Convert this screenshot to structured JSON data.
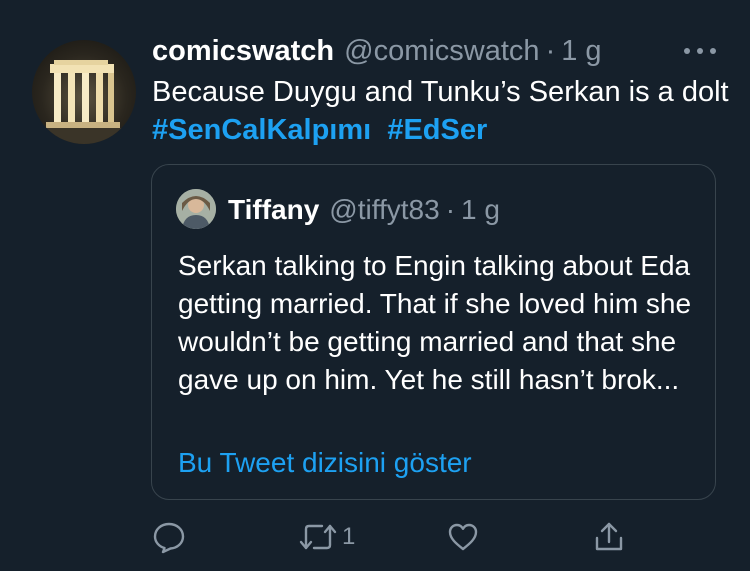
{
  "tweet": {
    "display_name": "comicswatch",
    "handle": "@comicswatch",
    "separator": "·",
    "time": "1 g",
    "text_prefix": "Because Duygu and Tunku’s Serkan is a dolt ",
    "hashtags": [
      "#SenCalKalpımı",
      "#EdSer"
    ]
  },
  "quoted_tweet": {
    "display_name": "Tiffany",
    "handle": "@tiffyt83",
    "separator": "·",
    "time": "1 g",
    "text": "Serkan talking to Engin talking about Eda getting married. That if she loved him she wouldn’t be getting married and that she gave up on him. Yet he still hasn’t brok...",
    "show_thread_label": "Bu Tweet dizisini göster"
  },
  "actions": {
    "reply_icon": "reply-icon",
    "retweet_icon": "retweet-icon",
    "retweet_count": "1",
    "like_icon": "heart-icon",
    "share_icon": "share-icon"
  },
  "colors": {
    "background": "#15202b",
    "text_primary": "#ffffff",
    "text_secondary": "#8b98a5",
    "accent": "#1da1f2",
    "border": "#38444d"
  }
}
